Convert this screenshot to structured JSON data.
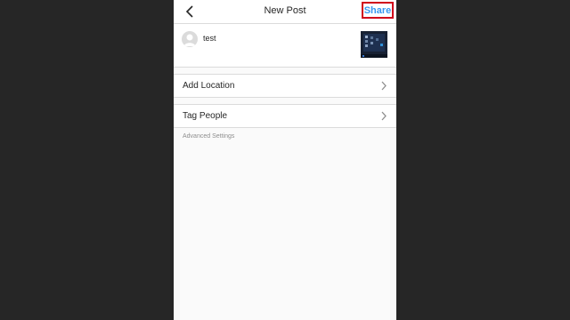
{
  "header": {
    "title": "New Post",
    "share_label": "Share",
    "share_color": "#3897f0",
    "back_icon": "chevron-left-icon"
  },
  "composer": {
    "username": "test",
    "avatar_icon": "default-avatar-icon",
    "thumbnail_desc": "thumbnail"
  },
  "options": [
    {
      "label": "Add Location",
      "icon": "chevron-right-icon"
    },
    {
      "label": "Tag People",
      "icon": "chevron-right-icon"
    }
  ],
  "advanced_settings_label": "Advanced Settings",
  "colors": {
    "backdrop": "#262626",
    "surface": "#ffffff",
    "app_background": "#fafafa",
    "divider": "#dbdbdb",
    "text": "#262626",
    "muted_text": "#8e8e8e",
    "highlight_border": "#d0021b"
  }
}
